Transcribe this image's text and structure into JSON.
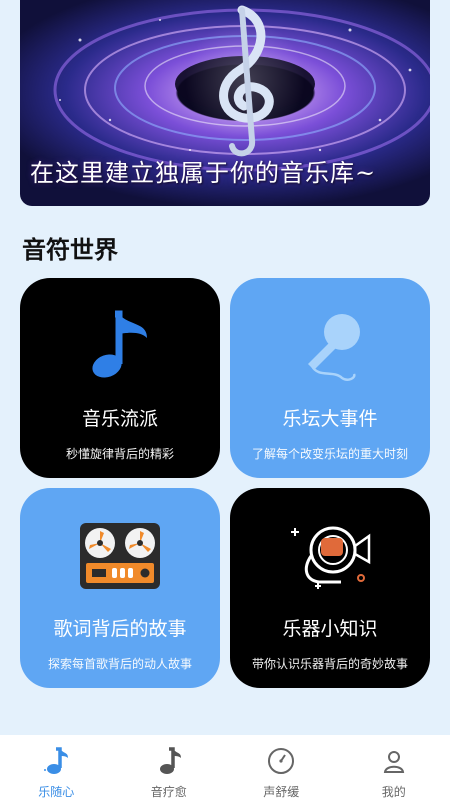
{
  "banner": {
    "caption": "在这里建立独属于你的音乐库~"
  },
  "section": {
    "title": "音符世界"
  },
  "cards": [
    {
      "title": "音乐流派",
      "subtitle": "秒懂旋律背后的精彩",
      "icon": "music-note-icon",
      "style": "black"
    },
    {
      "title": "乐坛大事件",
      "subtitle": "了解每个改变乐坛的重大时刻",
      "icon": "microphone-icon",
      "style": "blue"
    },
    {
      "title": "歌词背后的故事",
      "subtitle": "探索每首歌背后的动人故事",
      "icon": "tape-recorder-icon",
      "style": "blue"
    },
    {
      "title": "乐器小知识",
      "subtitle": "带你认识乐器背后的奇妙故事",
      "icon": "french-horn-icon",
      "style": "black"
    }
  ],
  "nav": [
    {
      "label": "乐随心",
      "icon": "music-note-icon",
      "active": true
    },
    {
      "label": "音疗愈",
      "icon": "music-note-icon",
      "active": false
    },
    {
      "label": "声舒缓",
      "icon": "gauge-icon",
      "active": false
    },
    {
      "label": "我的",
      "icon": "profile-icon",
      "active": false
    }
  ],
  "colors": {
    "background": "#e4f1fc",
    "card_black": "#000000",
    "card_blue": "#5fa6f3",
    "accent": "#3a8ee6"
  }
}
